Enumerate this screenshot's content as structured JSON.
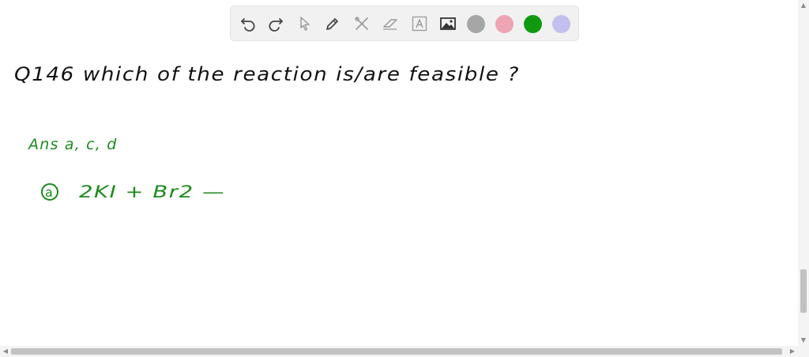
{
  "toolbar": {
    "tools": [
      "undo-icon",
      "redo-icon",
      "pointer-icon",
      "pen-icon",
      "tools-icon",
      "eraser-icon",
      "text-icon",
      "image-icon"
    ],
    "colors": [
      "#a6a6a6",
      "#eda5b4",
      "#119a11",
      "#c3c0ef"
    ]
  },
  "canvas": {
    "question": "Q146 which of the reaction is/are feasible ?",
    "answer": "Ans a, c, d",
    "reaction_label": "a",
    "reaction": "2KI + Br2 —"
  }
}
